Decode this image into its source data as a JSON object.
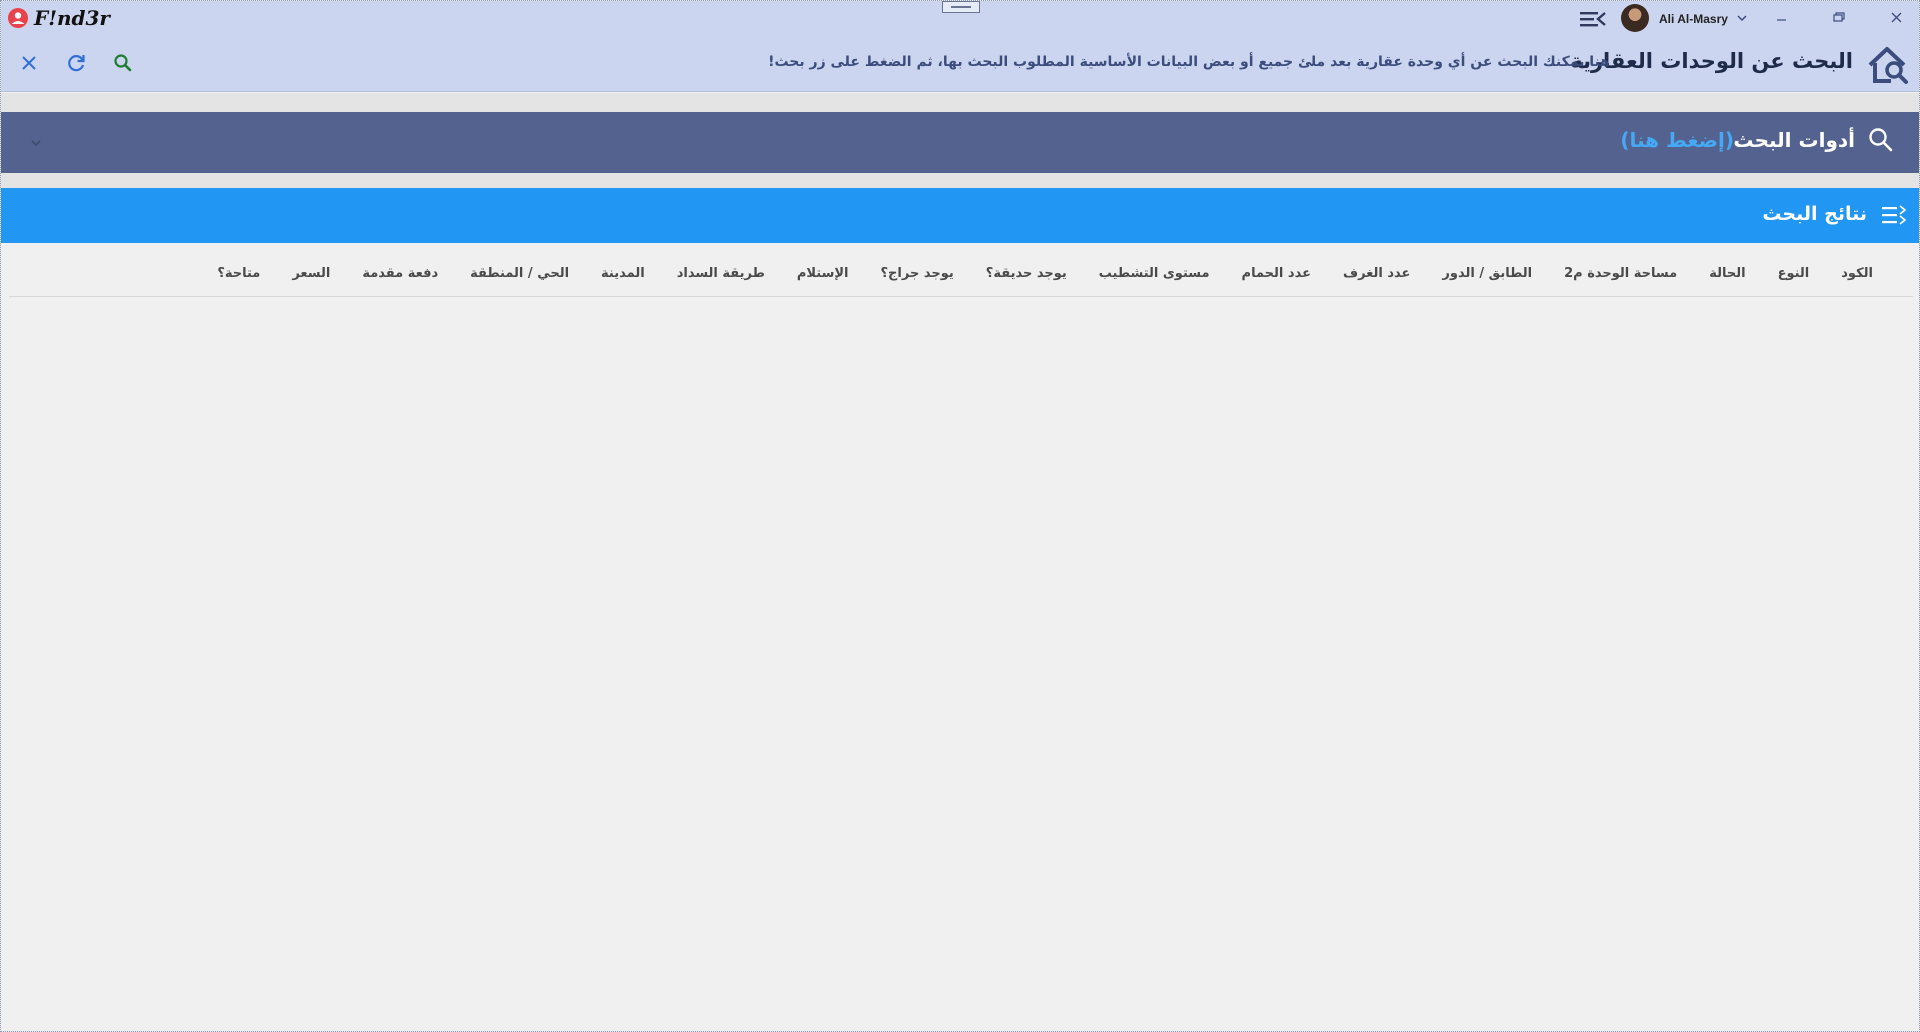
{
  "app": {
    "name": "F!nd3r",
    "user_name": "Ali Al-Masry"
  },
  "header": {
    "title": "البحث عن الوحدات العقارية",
    "hint": "هنا يمكنك البحث عن أي وحدة عقارية بعد ملئ جميع أو بعض البيانات الأساسية المطلوب البحث بها، ثم الضغط على زر بحث!"
  },
  "tools": {
    "title": "أدوات البحث",
    "link": "(إضغط هنا)"
  },
  "results": {
    "title": "نتائج البحث",
    "columns": [
      "الكود",
      "النوع",
      "الحالة",
      "مساحة الوحدة م2",
      "الطابق / الدور",
      "عدد الغرف",
      "عدد الحمام",
      "مستوى التشطيب",
      "يوجد حديقة؟",
      "يوجد جراج؟",
      "الإستلام",
      "طريقة السداد",
      "المدينة",
      "الحي / المنطقة",
      "دفعة مقدمة",
      "السعر",
      "متاحة؟"
    ]
  },
  "icons": {
    "logo": "location-pin-icon",
    "menu": "menu-collapse-icon",
    "house_search": "house-search-icon",
    "close": "close-icon",
    "refresh": "refresh-icon",
    "search": "search-icon",
    "results": "list-icon"
  },
  "colors": {
    "titlebar_bg": "#ccd5ef",
    "tools_bg": "#53628f",
    "results_bg": "#2196f3",
    "link": "#45a9f5",
    "logo_red": "#e8424a"
  }
}
